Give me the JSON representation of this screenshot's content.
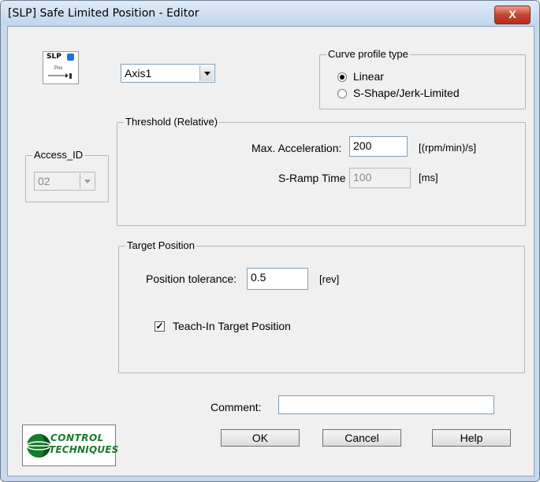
{
  "window": {
    "title": "[SLP] Safe Limited Position - Editor",
    "close_glyph": "X"
  },
  "slp_icon": {
    "top_label": "SLP",
    "bottom_label": "Pos"
  },
  "axis_select": {
    "value": "Axis1"
  },
  "curve_profile": {
    "title": "Curve profile type",
    "options": [
      {
        "label": "Linear",
        "selected": true
      },
      {
        "label": "S-Shape/Jerk-Limited",
        "selected": false
      }
    ]
  },
  "access_id": {
    "title": "Access_ID",
    "value": "02"
  },
  "threshold": {
    "title": "Threshold (Relative)",
    "max_accel_label": "Max. Acceleration:",
    "max_accel_value": "200",
    "max_accel_unit": "[(rpm/min)/s]",
    "sramp_label": "S-Ramp Time",
    "sramp_value": "100",
    "sramp_unit": "[ms]"
  },
  "target_position": {
    "title": "Target Position",
    "tolerance_label": "Position tolerance:",
    "tolerance_value": "0.5",
    "tolerance_unit": "[rev]",
    "teach_in_label": "Teach-In Target Position",
    "teach_in_checked": true
  },
  "comment": {
    "label": "Comment:",
    "value": ""
  },
  "buttons": {
    "ok": "OK",
    "cancel": "Cancel",
    "help": "Help"
  },
  "logo": {
    "line1": "CONTROL",
    "line2": "TECHNIQUES"
  },
  "colors": {
    "close_red": "#c7432f",
    "logo_green": "#1a7a2e",
    "slp_blue": "#1a73e8"
  }
}
